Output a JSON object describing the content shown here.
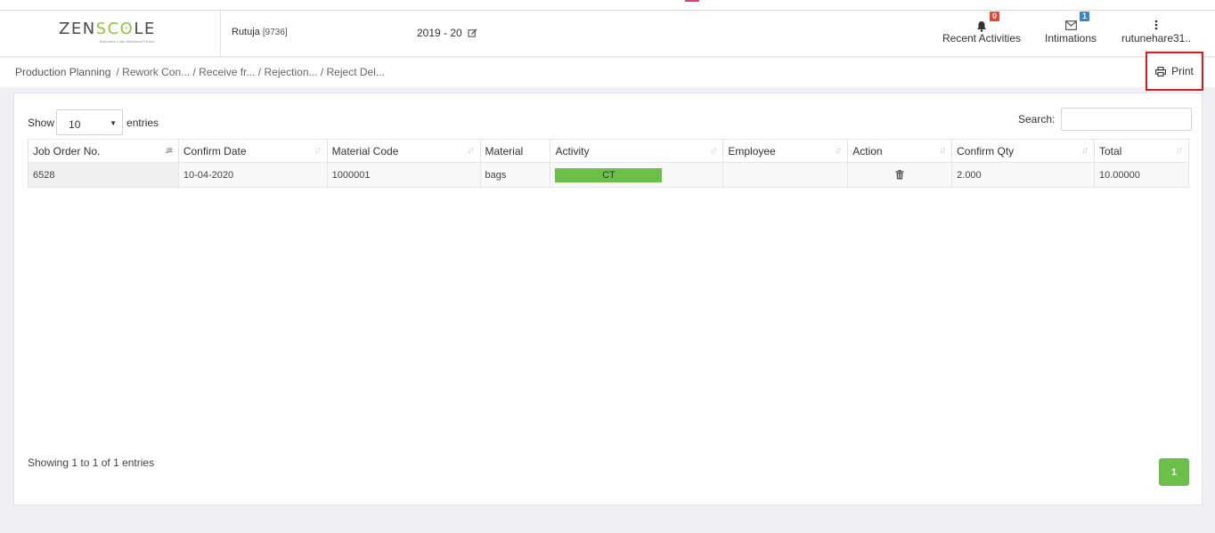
{
  "header": {
    "logo_word_a": "ZEN",
    "logo_word_b": "SC",
    "logo_word_c": "ʘ",
    "logo_word_d": "LE",
    "logo_tagline": "Business Lean Business Peace",
    "user_name": "Rutuja",
    "user_code": "[9736]",
    "fiscal_year": "2019 - 20",
    "recent_label": "Recent Activities",
    "recent_badge": "0",
    "intimations_label": "Intimations",
    "intimations_badge": "1",
    "account_label": "rutunehare31..",
    "icons": [
      "bell-icon",
      "envelope-icon",
      "kebab-menu-icon",
      "edit-icon"
    ]
  },
  "breadcrumb": {
    "root": "Production Planning",
    "trail": "/ Rework Con... / Receive fr... / Rejection... / Reject Del..."
  },
  "print_label": "Print",
  "table_controls": {
    "show_label": "Show",
    "page_size": "10",
    "entries_label": "entries",
    "search_label": "Search:",
    "search_value": ""
  },
  "table": {
    "columns": [
      "Job Order No.",
      "Confirm Date",
      "Material Code",
      "Material",
      "Activity",
      "Employee",
      "Action",
      "Confirm Qty",
      "Total"
    ],
    "rows": [
      {
        "job_order_no": "6528",
        "confirm_date": "10-04-2020",
        "material_code": "1000001",
        "material": "bags",
        "activity": "CT",
        "employee": "",
        "confirm_qty": "2.000",
        "total": "10.00000"
      }
    ]
  },
  "footer": {
    "info": "Showing 1 to 1 of 1 entries",
    "page": "1"
  },
  "colors": {
    "accent_green": "#6cc04a",
    "highlight_red": "#e0161b",
    "badge_red": "#e4472e",
    "badge_blue": "#3a87c8"
  }
}
